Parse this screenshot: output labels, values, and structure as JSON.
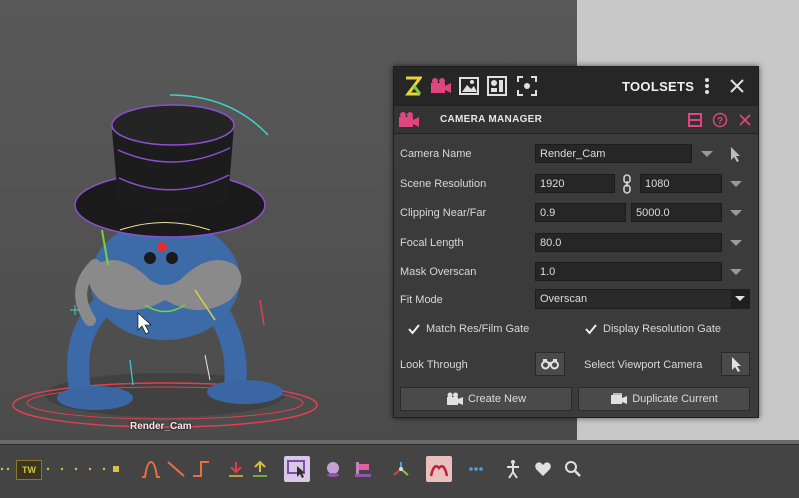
{
  "viewport": {
    "camera_label": "Render_Cam"
  },
  "panel": {
    "header_title": "TOOLSETS",
    "tool_title": "CAMERA MANAGER",
    "camera_name": {
      "label": "Camera Name",
      "value": "Render_Cam"
    },
    "scene_resolution": {
      "label": "Scene Resolution",
      "width": "1920",
      "height": "1080"
    },
    "clipping": {
      "label": "Clipping Near/Far",
      "near": "0.9",
      "far": "5000.0"
    },
    "focal_length": {
      "label": "Focal Length",
      "value": "80.0"
    },
    "mask_overscan": {
      "label": "Mask Overscan",
      "value": "1.0"
    },
    "fit_mode": {
      "label": "Fit Mode",
      "value": "Overscan"
    },
    "match_res": {
      "label": "Match Res/Film Gate",
      "checked": true
    },
    "display_res": {
      "label": "Display Resolution Gate",
      "checked": true
    },
    "look_through": {
      "label": "Look Through"
    },
    "select_viewport": {
      "label": "Select Viewport Camera"
    },
    "create_new": "Create New",
    "duplicate_current": "Duplicate Current"
  },
  "shelf": {
    "tw_label": "TW"
  },
  "colors": {
    "accent_pink": "#e0457b",
    "z_yellow": "#e6d23a",
    "z_green": "#6fd34c"
  }
}
